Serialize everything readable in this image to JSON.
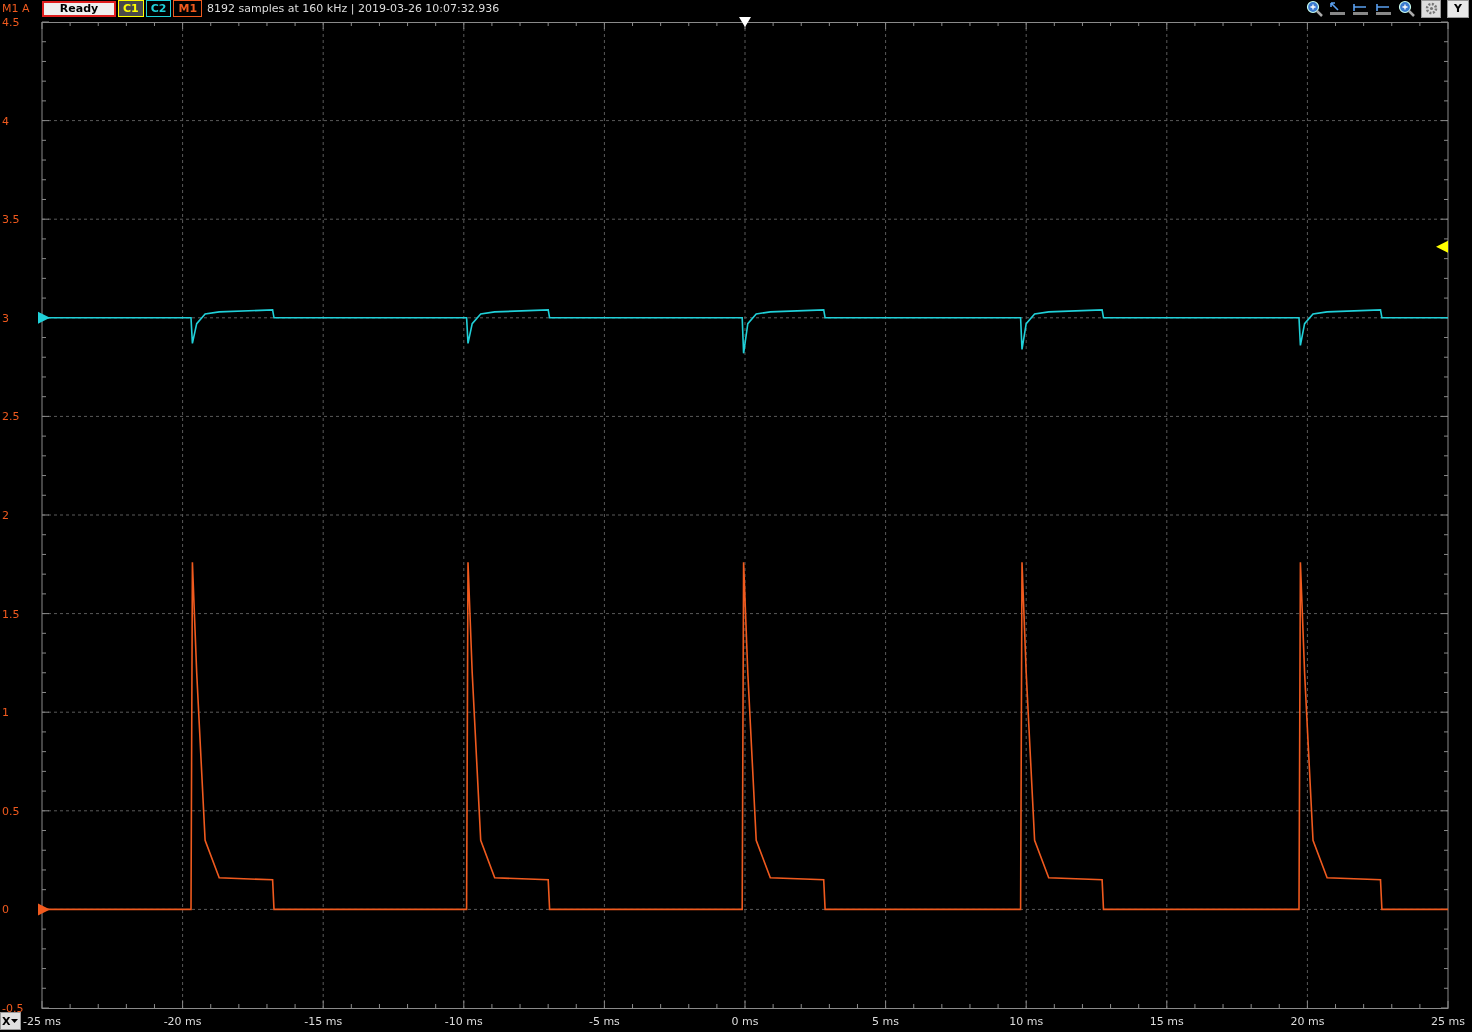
{
  "status": {
    "units_label": "M1 A",
    "state": "Ready"
  },
  "channels": [
    {
      "label": "C1",
      "color": "#ffff00",
      "active": false
    },
    {
      "label": "C2",
      "color": "#20d0d8",
      "active": true
    },
    {
      "label": "M1",
      "color": "#f05a1e",
      "active": true
    }
  ],
  "info": "8192 samples at 160 kHz | 2019-03-26 10:07:32.936",
  "y_button": "Y",
  "x_button": "X",
  "chart_data": {
    "type": "line",
    "grid": true,
    "xlim": [
      -25,
      25
    ],
    "ylim": [
      -0.5,
      4.5
    ],
    "yticks": [
      {
        "value": 4.5,
        "label": "4.5"
      },
      {
        "value": 4,
        "label": "4"
      },
      {
        "value": 3.5,
        "label": "3.5"
      },
      {
        "value": 3,
        "label": "3"
      },
      {
        "value": 2.5,
        "label": "2.5"
      },
      {
        "value": 2,
        "label": "2"
      },
      {
        "value": 1.5,
        "label": "1.5"
      },
      {
        "value": 1,
        "label": "1"
      },
      {
        "value": 0.5,
        "label": "0.5"
      },
      {
        "value": 0,
        "label": "0"
      },
      {
        "value": -0.5,
        "label": "-0.5"
      }
    ],
    "xticks": [
      {
        "value": -25,
        "label": "-25 ms"
      },
      {
        "value": -20,
        "label": "-20 ms"
      },
      {
        "value": -15,
        "label": "-15 ms"
      },
      {
        "value": -10,
        "label": "-10 ms"
      },
      {
        "value": -5,
        "label": "-5 ms"
      },
      {
        "value": 0,
        "label": "0 ms"
      },
      {
        "value": 5,
        "label": "5 ms"
      },
      {
        "value": 10,
        "label": "10 ms"
      },
      {
        "value": 15,
        "label": "15 ms"
      },
      {
        "value": 20,
        "label": "20 ms"
      },
      {
        "value": 25,
        "label": "25 ms"
      }
    ],
    "x": [
      -25,
      -19.7,
      -19.65,
      -19.5,
      -19.2,
      -18.7,
      -16.8,
      -16.75,
      -9.9,
      -9.85,
      -9.7,
      -9.4,
      -8.9,
      -7.0,
      -6.95,
      -0.1,
      -0.05,
      0.1,
      0.4,
      0.9,
      2.8,
      2.85,
      9.8,
      9.85,
      10.0,
      10.3,
      10.8,
      12.7,
      12.75,
      19.7,
      19.75,
      19.9,
      20.2,
      20.7,
      22.6,
      22.65,
      25
    ],
    "series": [
      {
        "color": "#20d0d8",
        "values": [
          3.0,
          3.0,
          2.87,
          2.97,
          3.02,
          3.03,
          3.04,
          3.0,
          3.0,
          2.87,
          2.97,
          3.02,
          3.03,
          3.04,
          3.0,
          3.0,
          2.82,
          2.97,
          3.02,
          3.03,
          3.04,
          3.0,
          3.0,
          2.84,
          2.97,
          3.02,
          3.03,
          3.04,
          3.0,
          3.0,
          2.86,
          2.97,
          3.02,
          3.03,
          3.04,
          3.0,
          3.0
        ]
      },
      {
        "color": "#f05a1e",
        "values": [
          0,
          0,
          1.76,
          1.2,
          0.35,
          0.16,
          0.15,
          0,
          0,
          1.76,
          1.2,
          0.35,
          0.16,
          0.15,
          0,
          0,
          1.76,
          1.2,
          0.35,
          0.16,
          0.15,
          0,
          0,
          1.76,
          1.2,
          0.35,
          0.16,
          0.15,
          0,
          0,
          1.76,
          1.2,
          0.35,
          0.16,
          0.15,
          0,
          0
        ]
      }
    ]
  }
}
